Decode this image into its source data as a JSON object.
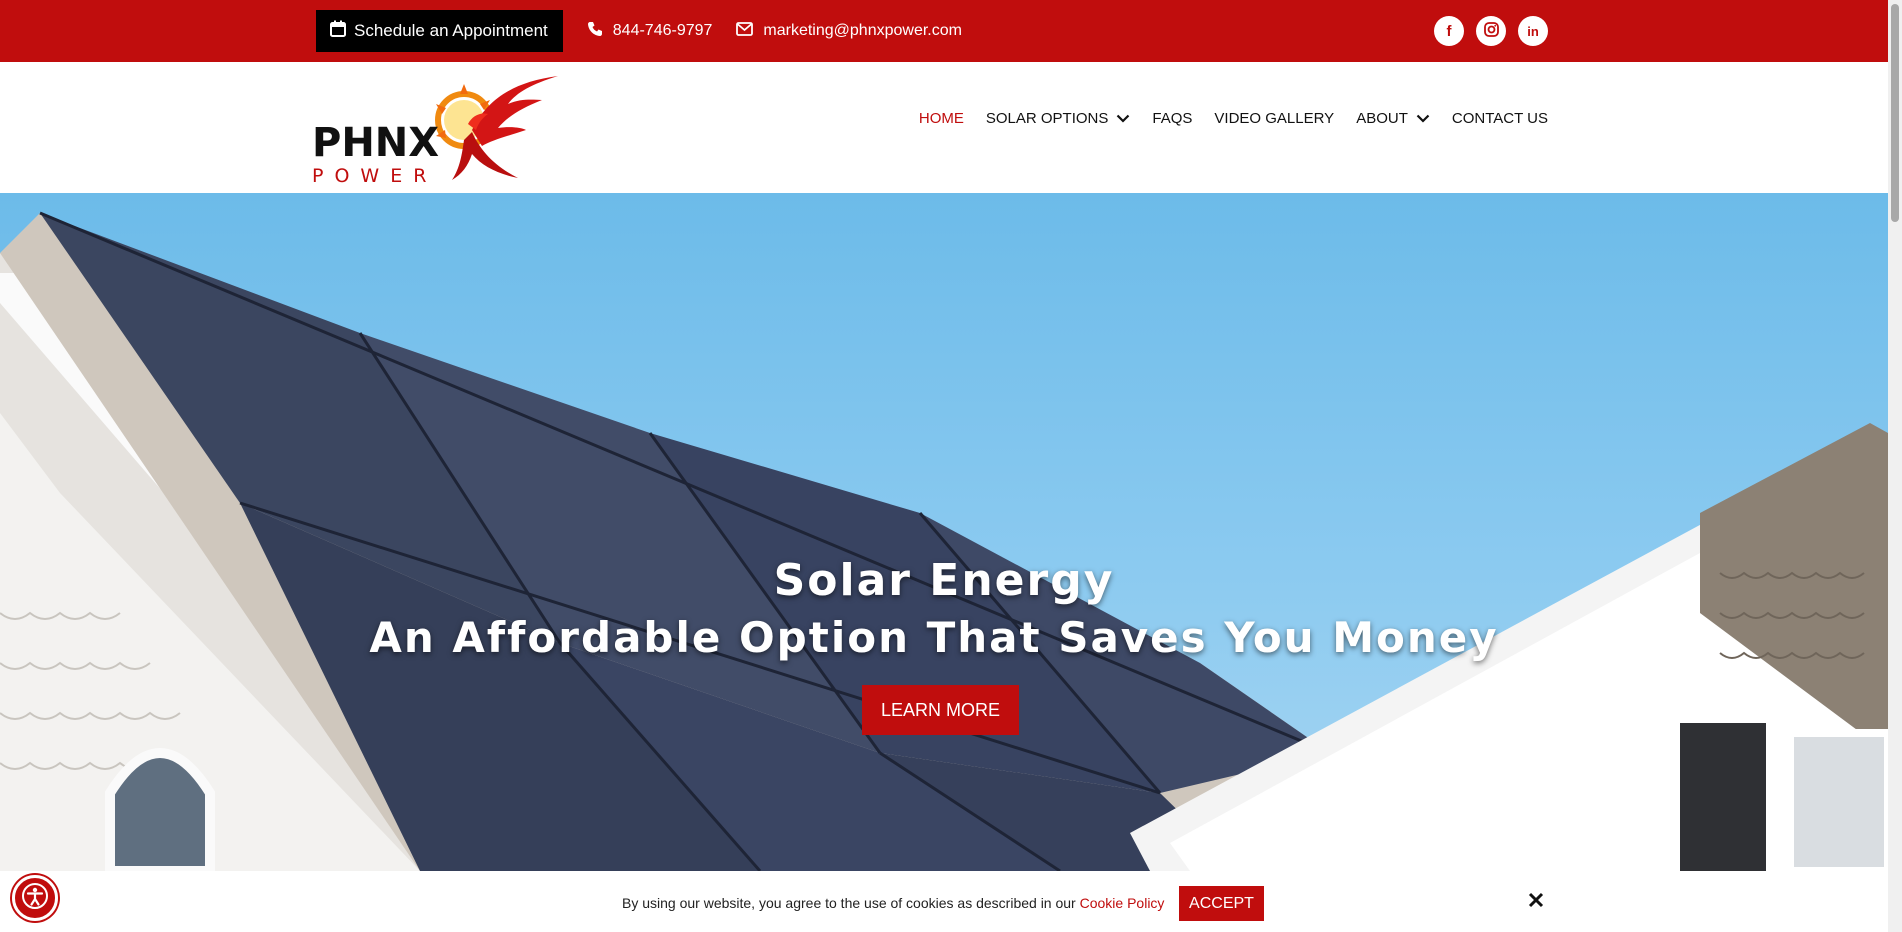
{
  "topbar": {
    "appointment_label": "Schedule an Appointment",
    "phone": "844-746-9797",
    "email": "marketing@phnxpower.com",
    "socials": [
      {
        "icon": "facebook-icon",
        "glyph": "f"
      },
      {
        "icon": "instagram-icon",
        "glyph": ""
      },
      {
        "icon": "linkedin-icon",
        "glyph": "in"
      }
    ],
    "bg_color": "#c00d0d"
  },
  "logo": {
    "line1": "PHNX",
    "line2": "POWER"
  },
  "nav": {
    "items": [
      {
        "label": "HOME",
        "active": true,
        "dropdown": false
      },
      {
        "label": "SOLAR OPTIONS",
        "active": false,
        "dropdown": true
      },
      {
        "label": "FAQS",
        "active": false,
        "dropdown": false
      },
      {
        "label": "VIDEO GALLERY",
        "active": false,
        "dropdown": false
      },
      {
        "label": "ABOUT",
        "active": false,
        "dropdown": true
      },
      {
        "label": "CONTACT US",
        "active": false,
        "dropdown": false
      }
    ]
  },
  "hero": {
    "title": "Solar Energy",
    "subtitle": "An Affordable Option That Saves You Money",
    "cta_label": "LEARN MORE"
  },
  "cookie": {
    "text": "By using our website, you agree to the use of cookies as described in our ",
    "link_label": "Cookie Policy",
    "accept_label": "ACCEPT"
  },
  "colors": {
    "accent": "#c00d0d",
    "nav_text": "#111111"
  }
}
